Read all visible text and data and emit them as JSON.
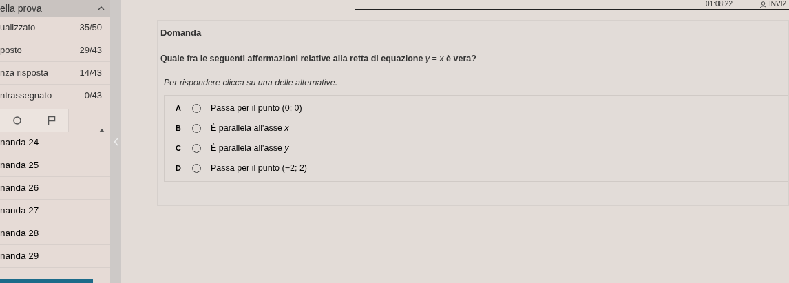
{
  "sidebar": {
    "title": "ella prova",
    "expanded": true,
    "stats": [
      {
        "label": "ualizzato",
        "value": "35/50"
      },
      {
        "label": "posto",
        "value": "29/43"
      },
      {
        "label": "nza risposta",
        "value": "14/43"
      },
      {
        "label": "ntrassegnato",
        "value": "0/43"
      }
    ],
    "questions": [
      {
        "label": "nanda 24"
      },
      {
        "label": "nanda 25"
      },
      {
        "label": "nanda 26"
      },
      {
        "label": "nanda 27"
      },
      {
        "label": "nanda 28"
      },
      {
        "label": "nanda 29"
      }
    ]
  },
  "header": {
    "timer": "01:08:22",
    "user": "INVI2"
  },
  "question": {
    "heading": "Domanda",
    "text": "**Quale fra le seguenti affermazioni relative alla retta di equazione** *y* = *x* **è vera?**",
    "instruction": "Per rispondere clicca su una delle alternative.",
    "options": [
      {
        "letter": "A",
        "text": "Passa per il punto (0; 0)",
        "selected": false
      },
      {
        "letter": "B",
        "text": "È parallela all'asse *x*",
        "selected": false
      },
      {
        "letter": "C",
        "text": "È parallela all'asse *y*",
        "selected": false
      },
      {
        "letter": "D",
        "text": "Passa per il punto (−2; 2)",
        "selected": false
      }
    ]
  }
}
